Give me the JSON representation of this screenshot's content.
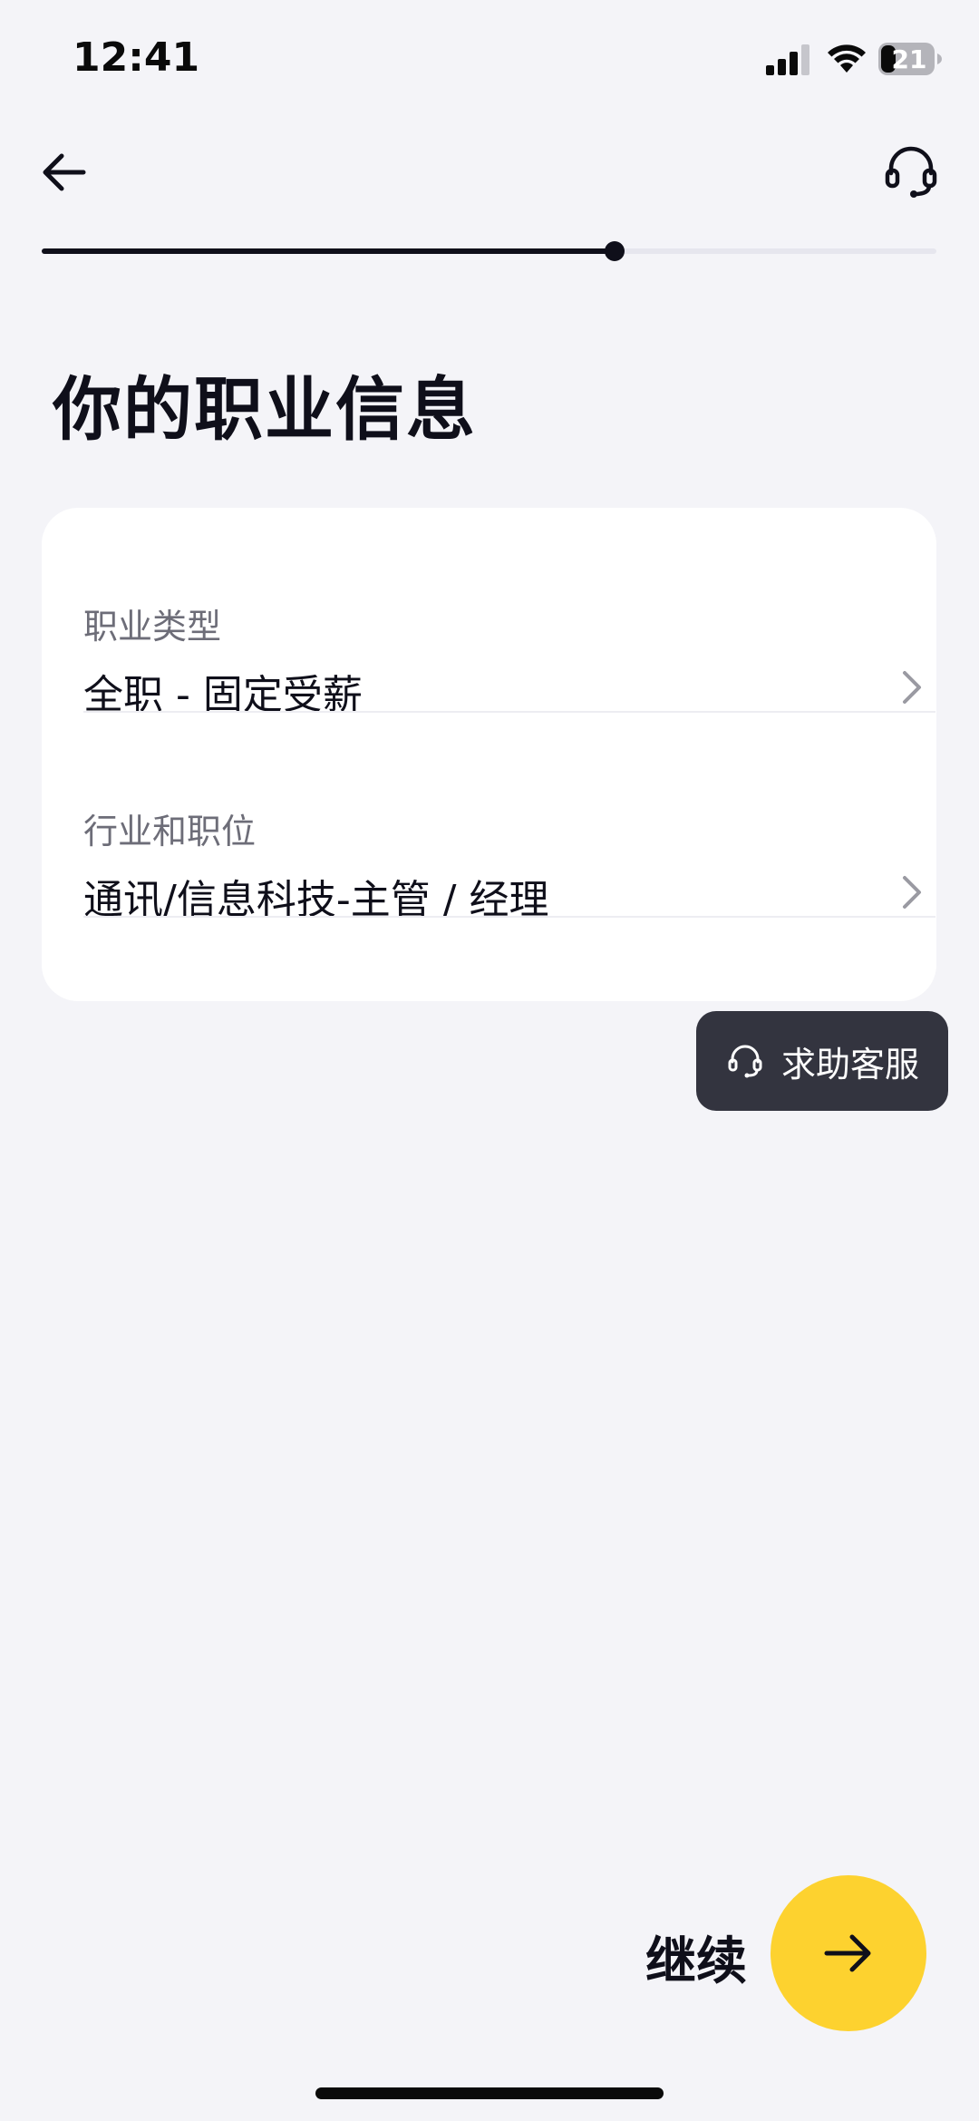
{
  "status_bar": {
    "time": "12:41",
    "battery_level": "21",
    "icons": [
      "signal-icon",
      "wifi-icon",
      "battery-icon"
    ]
  },
  "header": {
    "back_icon": "arrow-left-icon",
    "support_icon": "headset-icon"
  },
  "progress": {
    "fraction": 0.64
  },
  "page": {
    "title": "你的职业信息"
  },
  "form": {
    "fields": [
      {
        "label": "职业类型",
        "value": "全职 - 固定受薪",
        "icon": "chevron-right-icon"
      },
      {
        "label": "行业和职位",
        "value": "通讯/信息科技-主管 / 经理",
        "icon": "chevron-right-icon"
      }
    ]
  },
  "help": {
    "label": "求助客服",
    "icon": "headset-icon"
  },
  "continue": {
    "label": "继续",
    "icon": "arrow-right-icon"
  },
  "colors": {
    "background": "#f4f4f8",
    "card": "#ffffff",
    "primary_text": "#0f0f1a",
    "secondary_text": "#6d6d78",
    "accent": "#fdd22f",
    "help_button": "#33343f",
    "progress_track": "#e6e6ee"
  }
}
